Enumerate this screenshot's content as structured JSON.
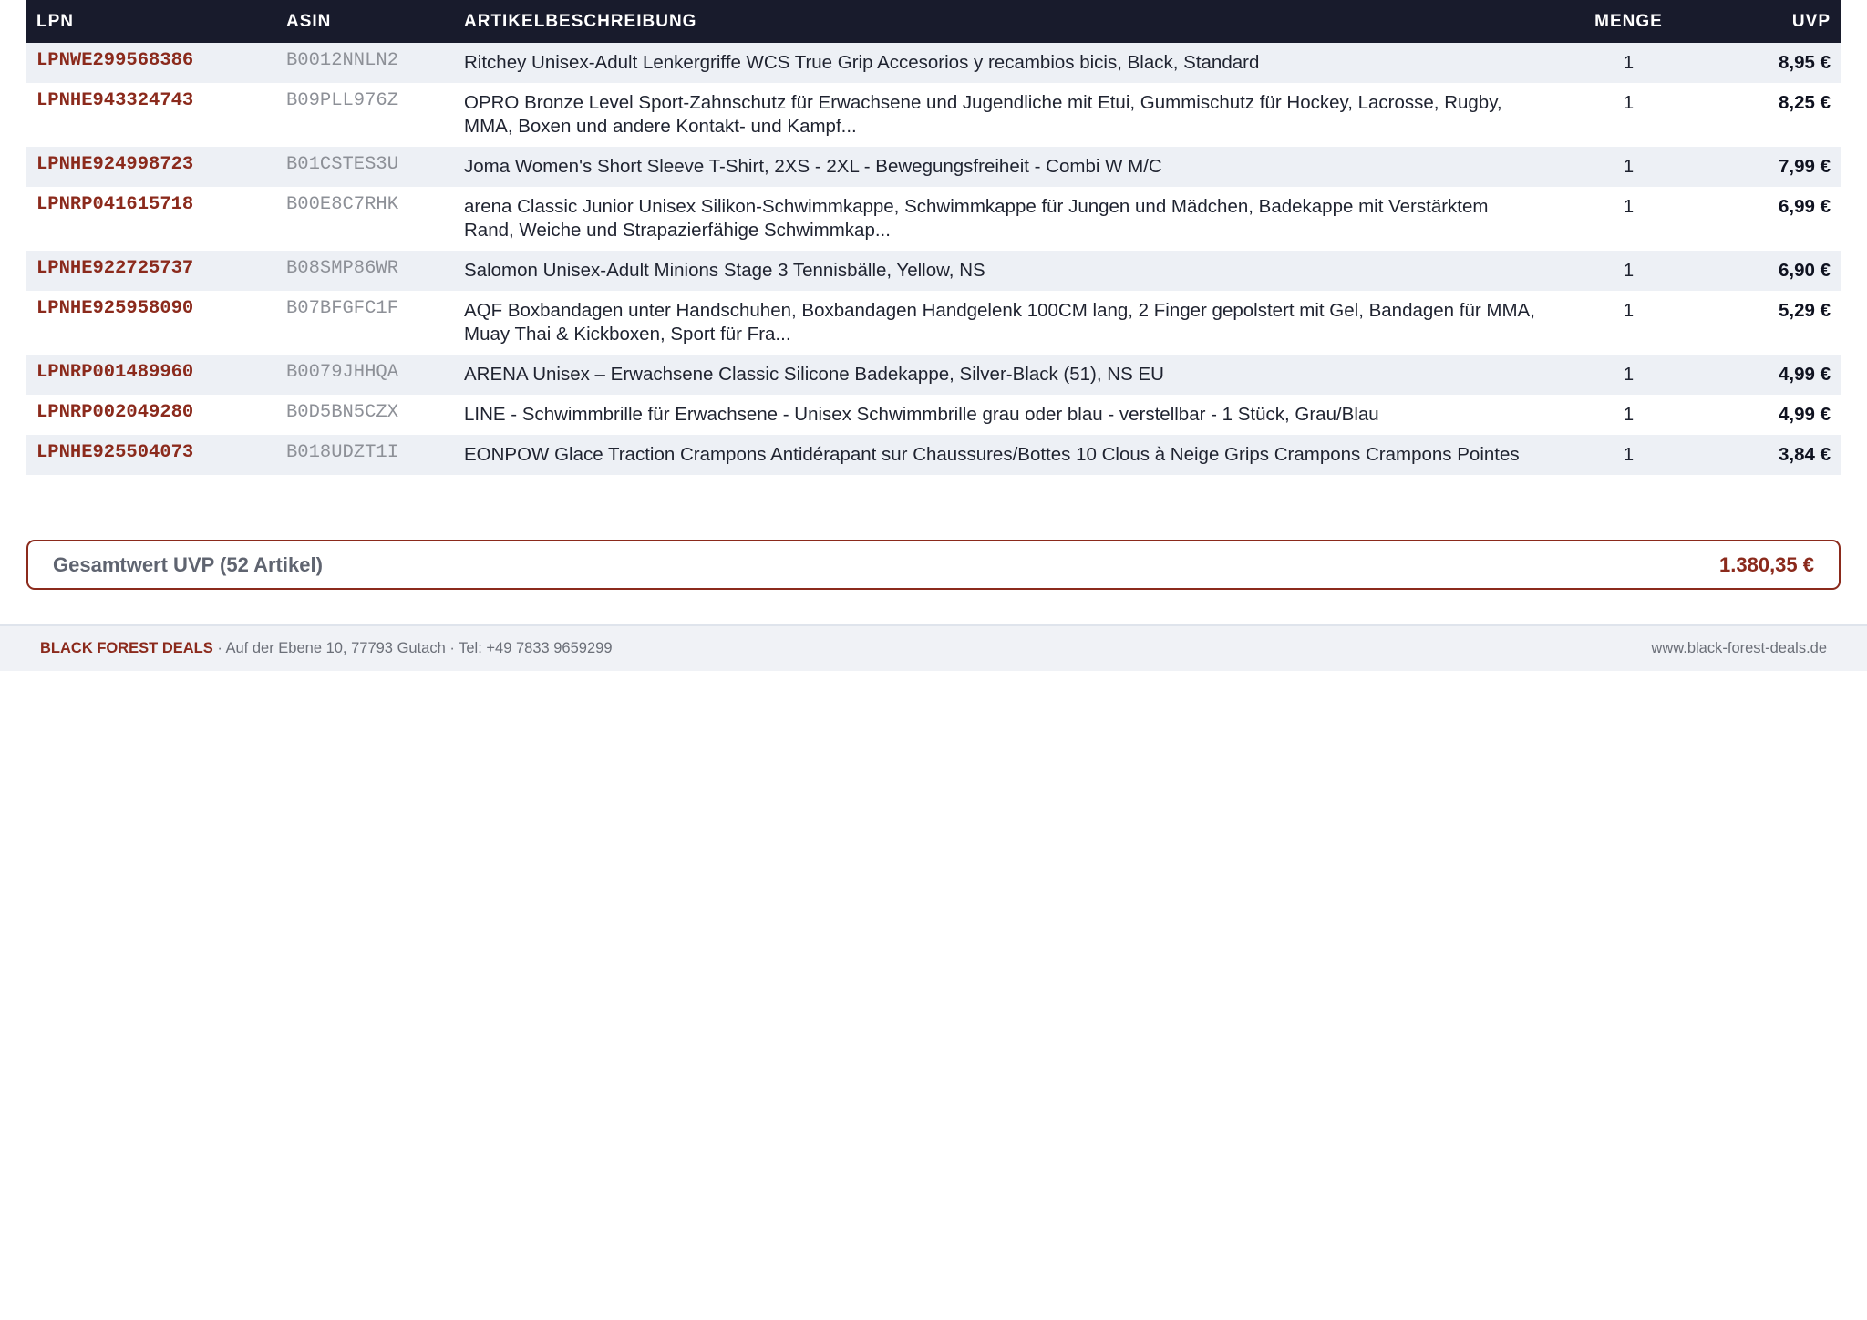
{
  "table": {
    "headers": {
      "lpn": "LPN",
      "asin": "ASIN",
      "description": "ARTIKELBESCHREIBUNG",
      "quantity": "MENGE",
      "uvp": "UVP"
    },
    "rows": [
      {
        "lpn": "LPNWE299568386",
        "asin": "B0012NNLN2",
        "description": "Ritchey Unisex-Adult Lenkergriffe WCS True Grip Accesorios y recambios bicis, Black, Standard",
        "quantity": "1",
        "uvp": "8,95 €"
      },
      {
        "lpn": "LPNHE943324743",
        "asin": "B09PLL976Z",
        "description": "OPRO Bronze Level Sport-Zahnschutz für Erwachsene und Jugendliche mit Etui, Gummischutz für Hockey, Lacrosse, Rugby, MMA, Boxen und andere Kontakt- und Kampf...",
        "quantity": "1",
        "uvp": "8,25 €"
      },
      {
        "lpn": "LPNHE924998723",
        "asin": "B01CSTES3U",
        "description": "Joma Women's Short Sleeve T-Shirt, 2XS - 2XL - Bewegungsfreiheit - Combi W M/C",
        "quantity": "1",
        "uvp": "7,99 €"
      },
      {
        "lpn": "LPNRP041615718",
        "asin": "B00E8C7RHK",
        "description": "arena Classic Junior Unisex Silikon-Schwimmkappe, Schwimmkappe für Jungen und Mädchen, Badekappe mit Verstärktem Rand, Weiche und Strapazierfähige Schwimmkap...",
        "quantity": "1",
        "uvp": "6,99 €"
      },
      {
        "lpn": "LPNHE922725737",
        "asin": "B08SMP86WR",
        "description": "Salomon Unisex-Adult Minions Stage 3 Tennisbälle, Yellow, NS",
        "quantity": "1",
        "uvp": "6,90 €"
      },
      {
        "lpn": "LPNHE925958090",
        "asin": "B07BFGFC1F",
        "description": "AQF Boxbandagen unter Handschuhen, Boxbandagen Handgelenk 100CM lang, 2 Finger gepolstert mit Gel, Bandagen für MMA, Muay Thai & Kickboxen, Sport für Fra...",
        "quantity": "1",
        "uvp": "5,29 €"
      },
      {
        "lpn": "LPNRP001489960",
        "asin": "B0079JHHQA",
        "description": "ARENA Unisex – Erwachsene Classic Silicone Badekappe, Silver-Black (51), NS EU",
        "quantity": "1",
        "uvp": "4,99 €"
      },
      {
        "lpn": "LPNRP002049280",
        "asin": "B0D5BN5CZX",
        "description": "LINE - Schwimmbrille für Erwachsene - Unisex Schwimmbrille grau oder blau - verstellbar - 1 Stück, Grau/Blau",
        "quantity": "1",
        "uvp": "4,99 €"
      },
      {
        "lpn": "LPNHE925504073",
        "asin": "B018UDZT1I",
        "description": "EONPOW Glace Traction Crampons Antidérapant sur Chaussures/Bottes 10 Clous à Neige Grips Crampons Crampons Pointes",
        "quantity": "1",
        "uvp": "3,84 €"
      }
    ]
  },
  "total": {
    "label": "Gesamtwert UVP (52 Artikel)",
    "value": "1.380,35 €"
  },
  "footer": {
    "brand": "BLACK FOREST DEALS",
    "address": " · Auf der Ebene 10, 77793 Gutach · Tel: +49 7833 9659299",
    "website": "www.black-forest-deals.de"
  },
  "colors": {
    "header_bg": "#181b2c",
    "accent": "#8b2a1c",
    "row_alt": "#edf0f5"
  }
}
